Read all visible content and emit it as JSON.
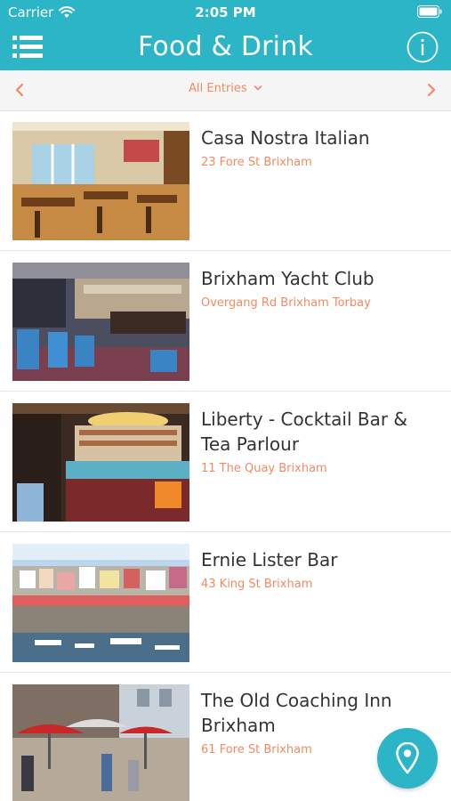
{
  "status_bar": {
    "carrier": "Carrier",
    "time": "2:05 PM",
    "wifi_icon": "wifi-icon",
    "battery_icon": "battery-icon"
  },
  "nav": {
    "title": "Food & Drink",
    "menu_icon": "list-menu-icon",
    "info_icon": "info-icon"
  },
  "filter": {
    "label": "All Entries",
    "prev_icon": "chevron-left-icon",
    "next_icon": "chevron-right-icon"
  },
  "entries": [
    {
      "title": "Casa Nostra Italian",
      "address": "23 Fore St Brixham"
    },
    {
      "title": "Brixham Yacht Club",
      "address": "Overgang Rd Brixham Torbay"
    },
    {
      "title": "Liberty - Cocktail Bar & Tea Parlour",
      "address": "11 The Quay Brixham"
    },
    {
      "title": "Ernie Lister Bar",
      "address": "43 King St Brixham"
    },
    {
      "title": "The Old Coaching Inn Brixham",
      "address": "61 Fore St Brixham"
    }
  ],
  "fab": {
    "icon": "map-pin-icon"
  },
  "colors": {
    "header": "#2bb5c7",
    "accent": "#f28a62",
    "title_text": "#333333",
    "filter_background": "#f5f5f5"
  }
}
